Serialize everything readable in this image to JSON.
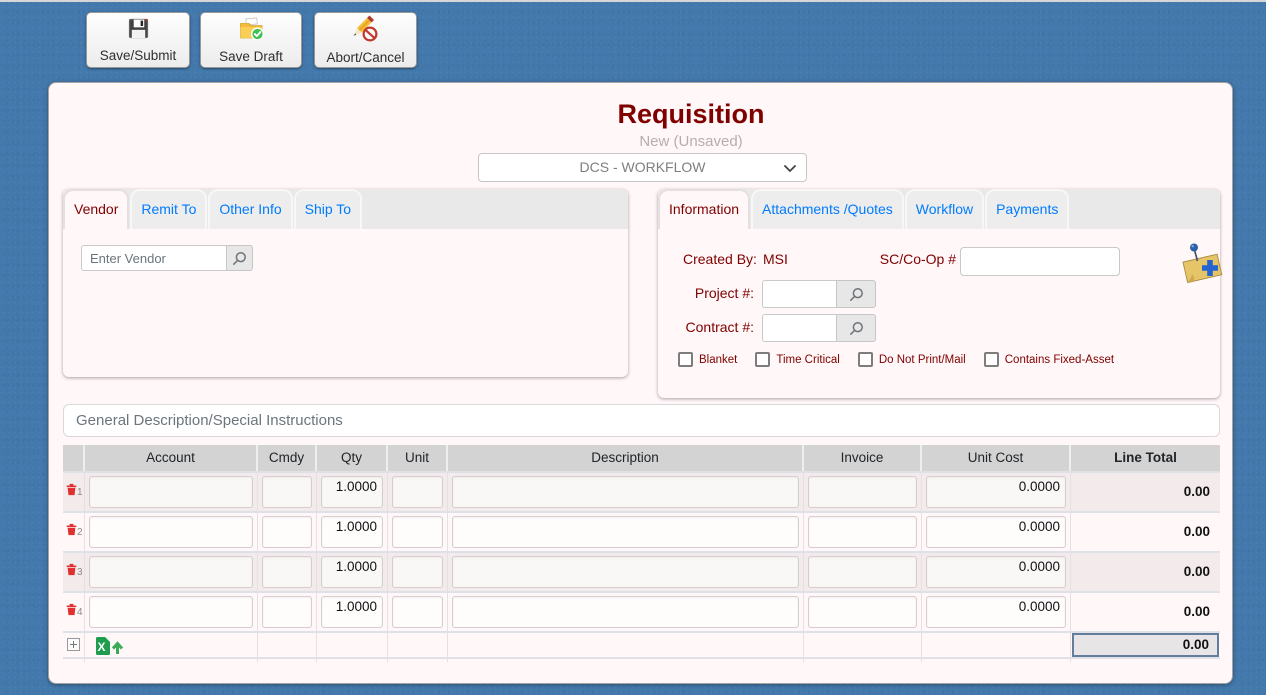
{
  "colors": {
    "background": "#4379ac",
    "panel": "#fff7f8",
    "accent": "#800000",
    "link": "#007bff",
    "table_header": "#d3d3d3",
    "total_border": "#647d9e"
  },
  "toolbar": {
    "save_submit": "Save/Submit",
    "save_draft": "Save Draft",
    "abort_cancel": "Abort/Cancel"
  },
  "header": {
    "title": "Requisition",
    "status": "New (Unsaved)",
    "workflow": "DCS - WORKFLOW"
  },
  "vendor_section": {
    "tabs": [
      "Vendor",
      "Remit To",
      "Other Info",
      "Ship To"
    ],
    "active_tab": "Vendor",
    "vendor_placeholder": "Enter Vendor",
    "vendor_value": ""
  },
  "info_section": {
    "tabs": [
      "Information",
      "Attachments /Quotes",
      "Workflow",
      "Payments"
    ],
    "active_tab": "Information",
    "created_by_label": "Created By:",
    "created_by_value": "MSI",
    "sc_coop_label": "SC/Co-Op #",
    "sc_coop_value": "",
    "project_label": "Project #:",
    "project_value": "",
    "contract_label": "Contract #:",
    "contract_value": "",
    "checkboxes": [
      {
        "label": "Blanket",
        "checked": false
      },
      {
        "label": "Time Critical",
        "checked": false
      },
      {
        "label": "Do Not Print/Mail",
        "checked": false
      },
      {
        "label": "Contains Fixed-Asset",
        "checked": false
      }
    ]
  },
  "general_description": {
    "placeholder": "General Description/Special Instructions",
    "value": ""
  },
  "line_items": {
    "columns": [
      "",
      "Account",
      "Cmdy",
      "Qty",
      "Unit",
      "Description",
      "Invoice",
      "Unit Cost",
      "Line Total"
    ],
    "rows": [
      {
        "num": "1",
        "account": "",
        "cmdy": "",
        "qty": "1.0000",
        "unit": "",
        "description": "",
        "invoice": "",
        "unit_cost": "0.0000",
        "line_total": "0.00"
      },
      {
        "num": "2",
        "account": "",
        "cmdy": "",
        "qty": "1.0000",
        "unit": "",
        "description": "",
        "invoice": "",
        "unit_cost": "0.0000",
        "line_total": "0.00"
      },
      {
        "num": "3",
        "account": "",
        "cmdy": "",
        "qty": "1.0000",
        "unit": "",
        "description": "",
        "invoice": "",
        "unit_cost": "0.0000",
        "line_total": "0.00"
      },
      {
        "num": "4",
        "account": "",
        "cmdy": "",
        "qty": "1.0000",
        "unit": "",
        "description": "",
        "invoice": "",
        "unit_cost": "0.0000",
        "line_total": "0.00"
      }
    ],
    "grand_total": "0.00"
  }
}
